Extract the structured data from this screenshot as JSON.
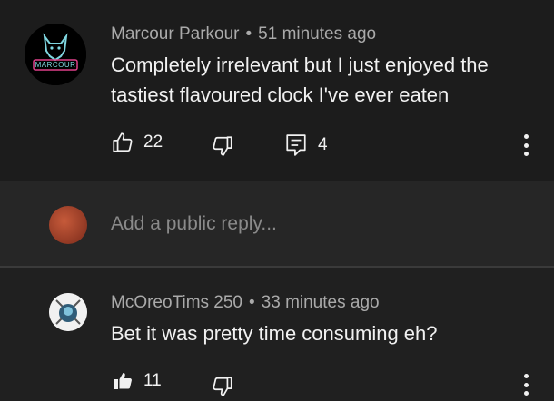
{
  "comment": {
    "author": "Marcour Parkour",
    "separator": "•",
    "time": "51 minutes ago",
    "text": "Completely irrelevant but I just enjoyed the tastiest flavoured clock I've ever eaten",
    "avatar_text": "MARCOUR",
    "likes": "22",
    "replies": "4",
    "icons": [
      "thumbs-up-icon",
      "thumbs-down-icon",
      "reply-icon",
      "more-vert-icon"
    ]
  },
  "reply_box": {
    "placeholder": "Add a public reply..."
  },
  "reply": {
    "author": "McOreoTims 250",
    "separator": "•",
    "time": "33 minutes ago",
    "text": "Bet it was pretty time consuming eh?",
    "likes": "11",
    "liked": true,
    "icons": [
      "thumbs-up-filled-icon",
      "thumbs-down-icon",
      "more-vert-icon"
    ]
  },
  "colors": {
    "background": "#1c1c1c",
    "reply_box_bg": "#262626",
    "text_primary": "#f1f1f1",
    "text_secondary": "#aaaaaa",
    "avatar_accent": "#e0408a"
  }
}
